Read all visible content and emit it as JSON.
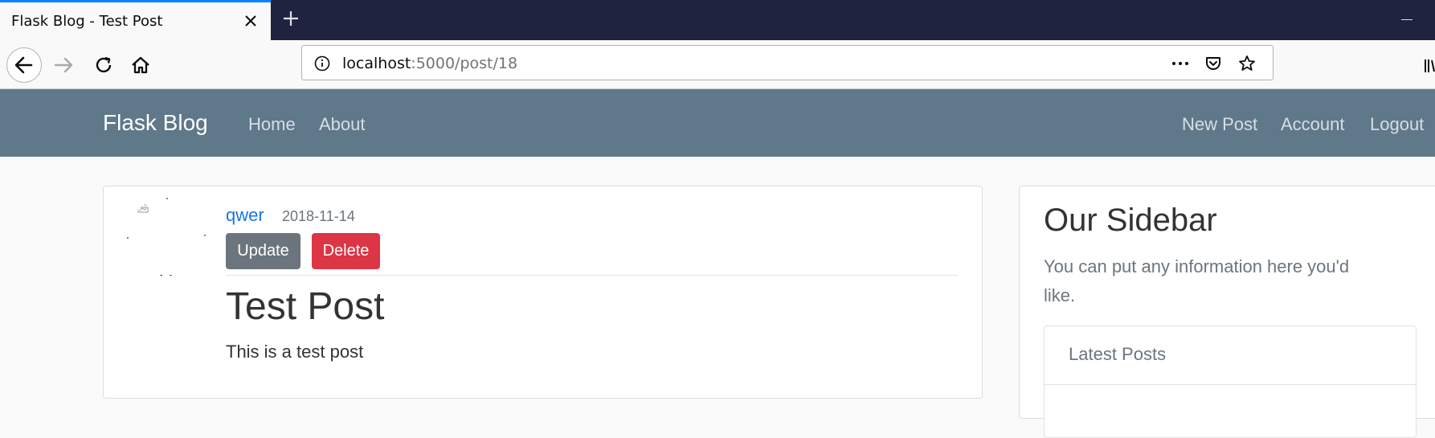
{
  "browser": {
    "tab_title": "Flask Blog - Test Post",
    "url_host": "localhost",
    "url_rest": ":5000/post/18"
  },
  "site": {
    "brand": "Flask Blog",
    "nav_left": [
      "Home",
      "About"
    ],
    "nav_right": [
      "New Post",
      "Account",
      "Logout"
    ]
  },
  "post": {
    "author": "qwer",
    "date": "2018-11-14",
    "update_label": "Update",
    "delete_label": "Delete",
    "title": "Test Post",
    "content": "This is a test post"
  },
  "sidebar": {
    "title": "Our Sidebar",
    "text": "You can put any information here you'd like.",
    "list_items": [
      "Latest Posts"
    ]
  },
  "colors": {
    "nav_bg": "#5f788a",
    "update_btn": "#6c757d",
    "delete_btn": "#dc3545",
    "link": "#1a73e8"
  }
}
